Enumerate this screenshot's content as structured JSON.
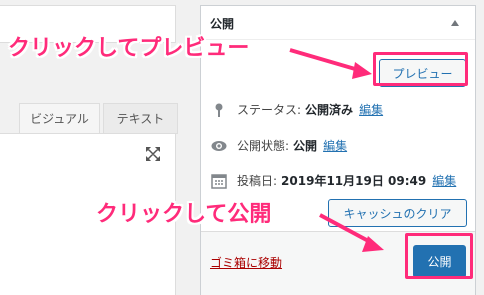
{
  "editor": {
    "tabs": [
      "ビジュアル",
      "テキスト"
    ],
    "icons": {
      "fullscreen": "fullscreen-icon"
    }
  },
  "publish_box": {
    "title": "公開",
    "preview_label": "プレビュー",
    "status": {
      "label": "ステータス:",
      "value": "公開済み",
      "edit": "編集",
      "icon": "pin-icon"
    },
    "visibility": {
      "label": "公開状態:",
      "value": "公開",
      "edit": "編集",
      "icon": "eye-icon"
    },
    "date": {
      "label": "投稿日:",
      "value": "2019年11月19日 09:49",
      "edit": "編集",
      "icon": "calendar-icon"
    },
    "clear_cache_label": "キャッシュのクリア",
    "trash_label": "ゴミ箱に移動",
    "publish_label": "公開"
  },
  "annotations": {
    "preview_note": "クリックしてプレビュー",
    "publish_note": "クリックして公開",
    "color": "#ff2b7a"
  }
}
